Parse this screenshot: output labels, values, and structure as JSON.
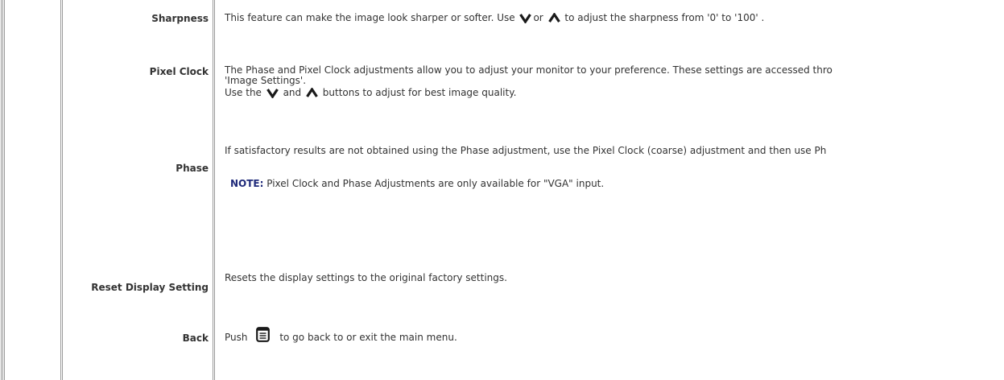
{
  "rows": {
    "sharpness": {
      "label": "Sharpness",
      "text_before": "This feature can make the image look sharper or softer. Use ",
      "text_mid": "or ",
      "text_after": " to adjust the sharpness from '0' to '100' ."
    },
    "pixel_clock": {
      "label": "Pixel Clock",
      "line1": "The Phase and Pixel Clock adjustments allow you to adjust your monitor to your preference. These settings are accessed thro",
      "line2": "'Image Settings'.",
      "line3_before": "Use the ",
      "line3_mid": " and ",
      "line3_after": " buttons to adjust for best image quality."
    },
    "phase": {
      "label": "Phase",
      "line1": "If satisfactory results are not obtained using the Phase adjustment, use the Pixel Clock (coarse) adjustment and then use Ph",
      "note_label": "NOTE:",
      "note_text": " Pixel Clock and Phase Adjustments are only available for \"VGA\" input."
    },
    "reset": {
      "label": "Reset Display Setting",
      "text": "Resets the display settings to the original factory settings."
    },
    "back": {
      "label": "Back",
      "text_before": "Push ",
      "text_after": "to go back to or exit the main menu."
    }
  },
  "icons": {
    "down": "chevron-down-icon",
    "up": "chevron-up-icon",
    "menu": "menu-button-icon"
  },
  "colors": {
    "note_label": "#1f2a7a",
    "rule": "#9a9a9a",
    "text": "#333333"
  }
}
